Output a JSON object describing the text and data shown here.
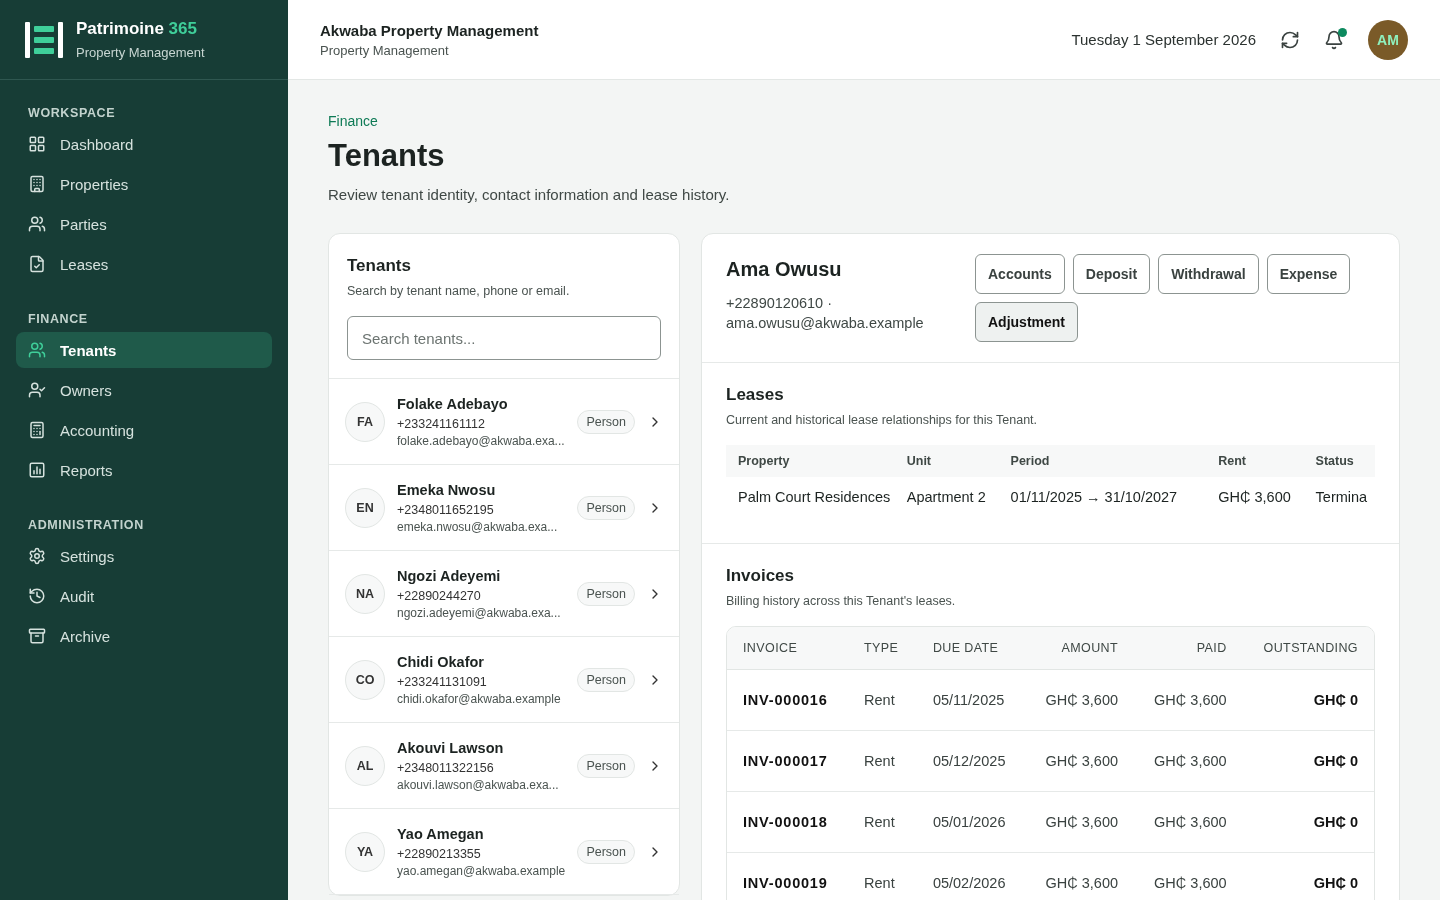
{
  "brand": {
    "name": "Patrimoine",
    "accent": "365",
    "subtitle": "Property Management"
  },
  "sidebar": {
    "sections": [
      {
        "title": "WORKSPACE",
        "items": [
          {
            "label": "Dashboard",
            "selected": false
          },
          {
            "label": "Properties",
            "selected": false
          },
          {
            "label": "Parties",
            "selected": false
          },
          {
            "label": "Leases",
            "selected": false
          }
        ]
      },
      {
        "title": "FINANCE",
        "items": [
          {
            "label": "Tenants",
            "selected": true
          },
          {
            "label": "Owners",
            "selected": false
          },
          {
            "label": "Accounting",
            "selected": false
          },
          {
            "label": "Reports",
            "selected": false
          }
        ]
      },
      {
        "title": "ADMINISTRATION",
        "items": [
          {
            "label": "Settings",
            "selected": false
          },
          {
            "label": "Audit",
            "selected": false
          },
          {
            "label": "Archive",
            "selected": false
          }
        ]
      }
    ]
  },
  "header": {
    "title": "Akwaba Property Management",
    "subtitle": "Property Management",
    "date": "Tuesday 1 September 2026",
    "notification": true,
    "avatar": "AM"
  },
  "page": {
    "breadcrumb": "Finance",
    "title": "Tenants",
    "description": "Review tenant identity, contact information and lease history."
  },
  "tenant_list": {
    "title": "Tenants",
    "hint": "Search by tenant name, phone or email.",
    "search": {
      "placeholder": "Search tenants..."
    },
    "tenants": [
      {
        "initials": "FA",
        "name": "Folake Adebayo",
        "phone": "+233241161112",
        "email": "folake.adebayo@akwaba.exa...",
        "type": "Person"
      },
      {
        "initials": "EN",
        "name": "Emeka Nwosu",
        "phone": "+2348011652195",
        "email": "emeka.nwosu@akwaba.exa...",
        "type": "Person"
      },
      {
        "initials": "NA",
        "name": "Ngozi Adeyemi",
        "phone": "+22890244270",
        "email": "ngozi.adeyemi@akwaba.exa...",
        "type": "Person"
      },
      {
        "initials": "CO",
        "name": "Chidi Okafor",
        "phone": "+233241131091",
        "email": "chidi.okafor@akwaba.example",
        "type": "Person"
      },
      {
        "initials": "AL",
        "name": "Akouvi Lawson",
        "phone": "+2348011322156",
        "email": "akouvi.lawson@akwaba.exa...",
        "type": "Person"
      },
      {
        "initials": "YA",
        "name": "Yao Amegan",
        "phone": "+22890213355",
        "email": "yao.amegan@akwaba.example",
        "type": "Person"
      }
    ]
  },
  "detail": {
    "name": "Ama Owusu",
    "contact": "+22890120610 ·",
    "email": "ama.owusu@akwaba.example",
    "actions": [
      {
        "label": "Accounts",
        "selected": false
      },
      {
        "label": "Deposit",
        "selected": false
      },
      {
        "label": "Withdrawal",
        "selected": false
      },
      {
        "label": "Expense",
        "selected": false
      },
      {
        "label": "Adjustment",
        "selected": true
      }
    ],
    "leases": {
      "title": "Leases",
      "description": "Current and historical lease relationships for this Tenant.",
      "columns": [
        "Property",
        "Unit",
        "Period",
        "Rent",
        "Status"
      ],
      "rows": [
        [
          "Palm Court Residences",
          "Apartment 2",
          "01/11/2025 → 31/10/2027",
          "GH₵ 3,600",
          "Termina"
        ]
      ]
    },
    "invoices": {
      "title": "Invoices",
      "description": "Billing history across this Tenant's leases.",
      "columns": [
        "INVOICE",
        "TYPE",
        "DUE DATE",
        "AMOUNT",
        "PAID",
        "OUTSTANDING"
      ],
      "rows": [
        [
          "INV-000016",
          "Rent",
          "05/11/2025",
          "GH₵ 3,600",
          "GH₵ 3,600",
          "GH₵ 0"
        ],
        [
          "INV-000017",
          "Rent",
          "05/12/2025",
          "GH₵ 3,600",
          "GH₵ 3,600",
          "GH₵ 0"
        ],
        [
          "INV-000018",
          "Rent",
          "05/01/2026",
          "GH₵ 3,600",
          "GH₵ 3,600",
          "GH₵ 0"
        ],
        [
          "INV-000019",
          "Rent",
          "05/02/2026",
          "GH₵ 3,600",
          "GH₵ 3,600",
          "GH₵ 0"
        ]
      ]
    }
  }
}
